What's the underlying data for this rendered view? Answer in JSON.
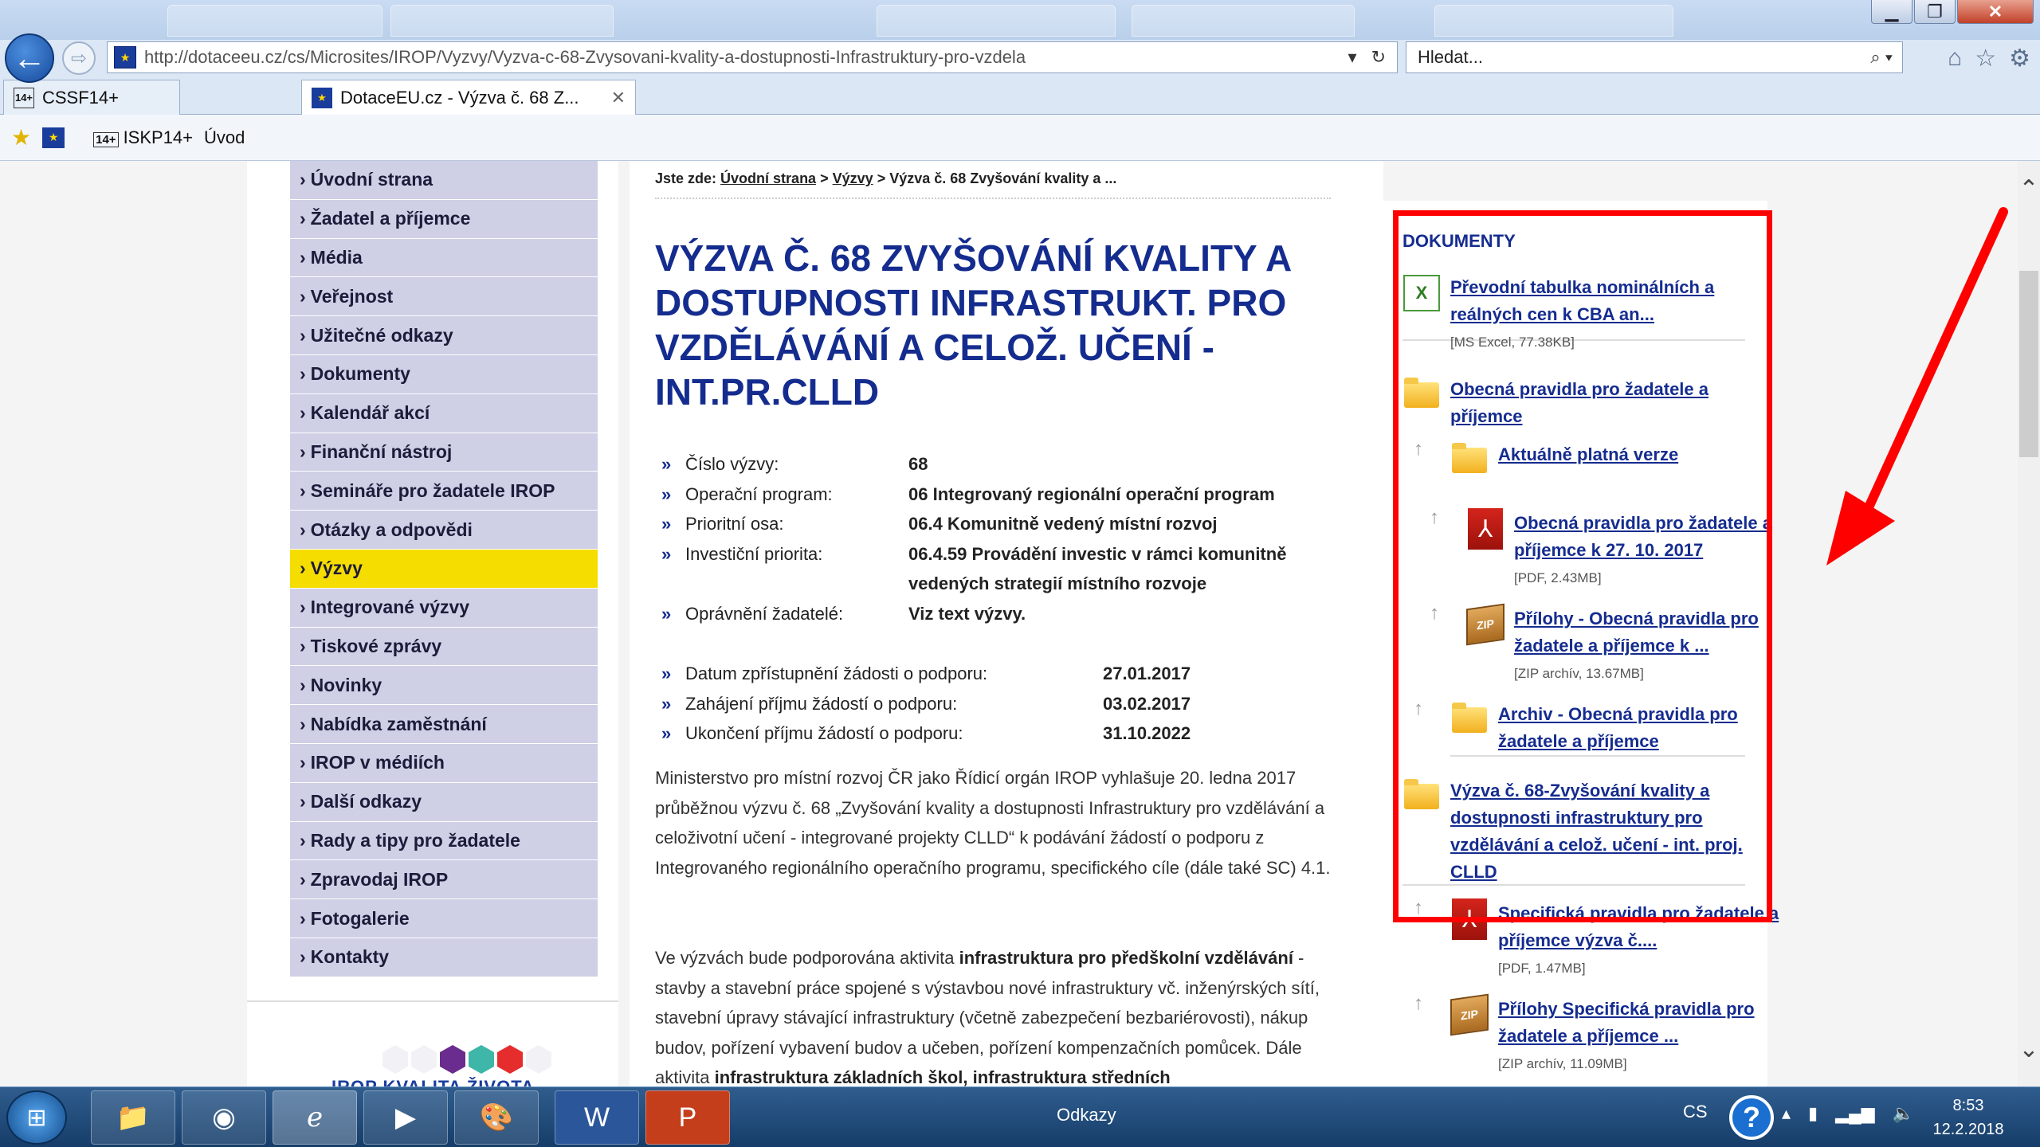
{
  "browser": {
    "url": "http://dotaceeu.cz/cs/Microsites/IROP/Vyzvy/Vyzva-c-68-Zvysovani-kvality-a-dostupnosti-Infrastruktury-pro-vzdela",
    "search_placeholder": "Hledat...",
    "tabs": [
      {
        "label": "CSSF14+",
        "icon": "cssf-icon",
        "active": false
      },
      {
        "label": "DotaceEU.cz - Výzva č. 68 Z...",
        "icon": "eu-flag-icon",
        "active": true
      }
    ],
    "favorites": [
      {
        "label": "ISKP14+"
      },
      {
        "label": "Úvod"
      }
    ],
    "window_buttons": {
      "minimize": "▁",
      "maximize": "❐",
      "close": "✕"
    }
  },
  "nav": {
    "items": [
      {
        "label": "Úvodní strana"
      },
      {
        "label": "Žadatel a příjemce"
      },
      {
        "label": "Média"
      },
      {
        "label": "Veřejnost"
      },
      {
        "label": "Užitečné odkazy"
      },
      {
        "label": "Dokumenty"
      },
      {
        "label": "Kalendář akcí"
      },
      {
        "label": "Finanční nástroj"
      },
      {
        "label": "Semináře pro žadatele IROP"
      },
      {
        "label": "Otázky a odpovědi"
      },
      {
        "label": "Výzvy",
        "active": true
      },
      {
        "label": "Integrované výzvy"
      },
      {
        "label": "Tiskové zprávy"
      },
      {
        "label": "Novinky"
      },
      {
        "label": "Nabídka zaměstnání"
      },
      {
        "label": "IROP v médiích"
      },
      {
        "label": "Další odkazy"
      },
      {
        "label": "Rady a tipy pro žadatele"
      },
      {
        "label": "Zpravodaj IROP"
      },
      {
        "label": "Fotogalerie"
      },
      {
        "label": "Kontakty"
      }
    ],
    "logo_text": "IROP   KVALITA ŽIVOTA"
  },
  "breadcrumb": {
    "prefix": "Jste zde:",
    "home": "Úvodní strana",
    "sep": ">",
    "section": "Výzvy",
    "current": "> Výzva č. 68 Zvyšování kvality a ..."
  },
  "page_title": "VÝZVA Č. 68 ZVYŠOVÁNÍ KVALITY A DOSTUPNOSTI INFRASTRUKT. PRO VZDĚLÁVÁNÍ A CELOŽ. UČENÍ - INT.PR.CLLD",
  "info": [
    {
      "k": "Číslo výzvy:",
      "v": "68"
    },
    {
      "k": "Operační program:",
      "v": "06 Integrovaný regionální operační program"
    },
    {
      "k": "Prioritní osa:",
      "v": "06.4 Komunitně vedený místní rozvoj"
    },
    {
      "k": "Investiční priorita:",
      "v": "06.4.59 Provádění investic v rámci komunitně vedených strategií místního rozvoje"
    },
    {
      "k": "Oprávnění žadatelé:",
      "v": "Viz text výzvy."
    }
  ],
  "dates": [
    {
      "k": "Datum zpřístupnění žádosti o podporu:",
      "v": "27.01.2017"
    },
    {
      "k": "Zahájení příjmu žádostí o podporu:",
      "v": "03.02.2017"
    },
    {
      "k": "Ukončení příjmu žádostí o podporu:",
      "v": "31.10.2022"
    }
  ],
  "paragraph1": "Ministerstvo pro místní rozvoj ČR jako Řídicí orgán IROP vyhlašuje 20. ledna 2017 průběžnou výzvu č. 68 „Zvyšování kvality a dostupnosti Infrastruktury pro vzdělávání a celoživotní učení - integrované projekty CLLD“ k podávání žádostí o podporu z Integrovaného regionálního operačního programu, specifického cíle  (dále také SC) 4.1.",
  "paragraph2": {
    "p1": "Ve výzvách bude podporována aktivita ",
    "b1": "infrastruktura pro předškolní vzdělávání",
    "p2": " - stavby a stavební práce spojené s výstavbou nové infrastruktury vč. inženýrských sítí, stavební úpravy stávající infrastruktury (včetně zabezpečení bezbariérovosti), nákup budov, pořízení vybavení budov a učeben, pořízení kompenzačních pomůcek. Dále aktivita ",
    "b2": "infrastruktura základních škol, infrastruktura středních"
  },
  "documents": {
    "heading": "DOKUMENTY",
    "items": [
      {
        "title": "Převodní tabulka nominálních a reálných cen k CBA an...",
        "meta": "[MS Excel, 77.38KB]",
        "icon": "excel-icon"
      },
      {
        "title": "Obecná pravidla pro žadatele a příjemce",
        "meta": "",
        "icon": "folder-icon"
      },
      {
        "title": "Aktuálně platná verze",
        "meta": "",
        "icon": "folder-icon"
      },
      {
        "title": "Obecná pravidla pro žadatele a příjemce k 27. 10. 2017",
        "meta": "[PDF, 2.43MB]",
        "icon": "pdf-icon"
      },
      {
        "title": "Přílohy - Obecná pravidla pro žadatele a příjemce k ...",
        "meta": "[ZIP archív, 13.67MB]",
        "icon": "zip-icon"
      },
      {
        "title": "Archiv - Obecná pravidla pro žadatele a příjemce",
        "meta": "",
        "icon": "folder-icon"
      },
      {
        "title": "Výzva č. 68-Zvyšování kvality a dostupnosti infrastruktury pro vzdělávání a celož. učení - int. proj. CLLD",
        "meta": "",
        "icon": "folder-icon"
      },
      {
        "title": "Specifická pravidla pro žadatele a příjemce  výzva č....",
        "meta": "[PDF, 1.47MB]",
        "icon": "pdf-icon"
      },
      {
        "title": "Přílohy  Specifická pravidla pro žadatele a příjemce  ...",
        "meta": "[ZIP archív, 11.09MB]",
        "icon": "zip-icon"
      }
    ]
  },
  "annotation": {
    "highlight_color": "#ff0000"
  },
  "taskbar": {
    "odkazy": "Odkazy",
    "lang": "CS",
    "time": "8:53",
    "date": "12.2.2018"
  }
}
